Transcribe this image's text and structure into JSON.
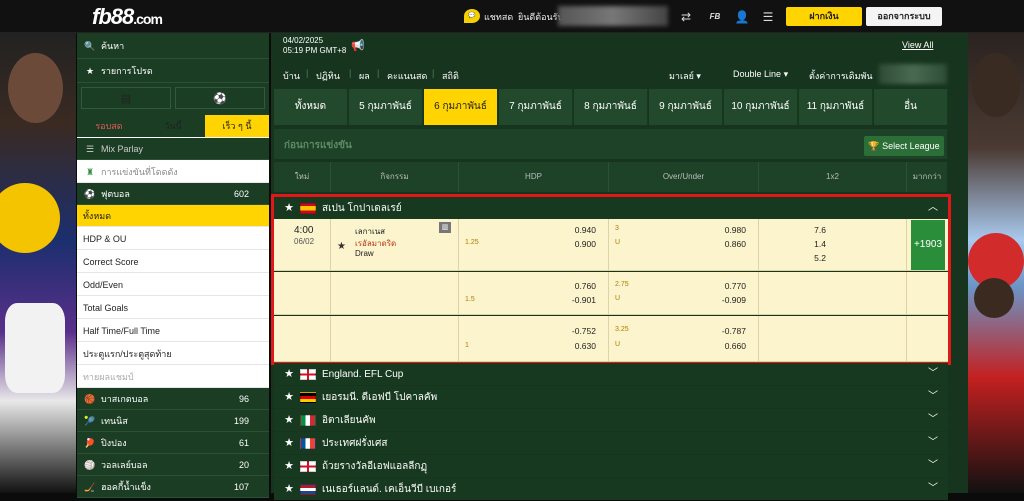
{
  "topbar": {
    "logo": "fb88",
    "logo_suffix": ".com",
    "chat": "แชทสด",
    "welcome": "ยินดีต้อนรับ",
    "deposit": "ฝากเงิน",
    "logout": "ออกจากระบบ"
  },
  "sidebar": {
    "search": "ค้นหา",
    "favorites": "รายการโปรด",
    "time_tabs": [
      "รอบสด",
      "วันนี้",
      "เร็ว ๆ นี้"
    ],
    "mix_parlay": "Mix Parlay",
    "upcoming": "การแข่งขันที่โดดดัง",
    "football": "ฟุตบอล",
    "football_count": "602",
    "bet_types": [
      "ทั้งหมด",
      "HDP & OU",
      "Correct Score",
      "Odd/Even",
      "Total Goals",
      "Half Time/Full Time",
      "ประตูแรก/ประตูสุดท้าย",
      "ทายผลแชมป์"
    ],
    "sports": [
      {
        "name": "บาสเกตบอล",
        "count": "96"
      },
      {
        "name": "เทนนิส",
        "count": "199"
      },
      {
        "name": "ปิงปอง",
        "count": "61"
      },
      {
        "name": "วอลเลย์บอล",
        "count": "20"
      },
      {
        "name": "ฮอคกี้น้ำแข็ง",
        "count": "107"
      }
    ]
  },
  "main": {
    "date": "04/02/2025",
    "time": "05:19 PM GMT+8",
    "view_all": "View All",
    "nav": [
      "บ้าน",
      "ปฏิทิน",
      "ผล",
      "คะแนนสด",
      "สถิติ"
    ],
    "market": "มาเลย์",
    "odds_type": "Double Line",
    "settings": "ตั้งค่าการเดิมพัน",
    "day_tabs": [
      "ทั้งหมด",
      "5 กุมภาพันธ์",
      "6 กุมภาพันธ์",
      "7 กุมภาพันธ์",
      "8 กุมภาพันธ์",
      "9 กุมภาพันธ์",
      "10 กุมภาพันธ์",
      "11 กุมภาพันธ์",
      "อื่น"
    ],
    "section": "ก่อนการแข่งขัน",
    "select_league": "Select League",
    "columns": [
      "ใหม่",
      "กิจกรรม",
      "HDP",
      "Over/Under",
      "1x2",
      "มากกว่า"
    ]
  },
  "featured": {
    "league": "สเปน โกปาเดลเรย์",
    "time": "4:00",
    "date": "06/02",
    "home": "เลกาเนส",
    "away": "เรอัลมาดริด",
    "draw": "Draw",
    "more": "+1903",
    "rows": [
      {
        "hdp_line": "1.25",
        "hdp_home": "0.940",
        "hdp_away": "0.900",
        "ou_line": "3",
        "ou_over": "0.980",
        "ou_under": "0.860",
        "x1": "7.6",
        "xx": "1.4",
        "x2": "5.2"
      },
      {
        "hdp_line": "1.5",
        "hdp_home": "0.760",
        "hdp_away": "-0.901",
        "ou_line": "2.75",
        "ou_over": "0.770",
        "ou_under": "-0.909"
      },
      {
        "hdp_line": "1",
        "hdp_home": "-0.752",
        "hdp_away": "0.630",
        "ou_line": "3.25",
        "ou_over": "-0.787",
        "ou_under": "0.660"
      }
    ],
    "u_label": "U"
  },
  "leagues": [
    "England. EFL Cup",
    "เยอรมนี. ดีเอฟบี โปคาลคัพ",
    "อิตาเลียนคัพ",
    "ประเทศฝรั่งเศส",
    "ถ้วยรางวัลอีเอฟแอลลีกฏุ",
    "เนเธอร์แลนด์. เคเอ็นวีบี เบเกอร์"
  ],
  "colors": {
    "accent": "#ffd400",
    "dark_green": "#16341e",
    "row_bg": "#fbf4cc",
    "highlight": "#e21818"
  }
}
